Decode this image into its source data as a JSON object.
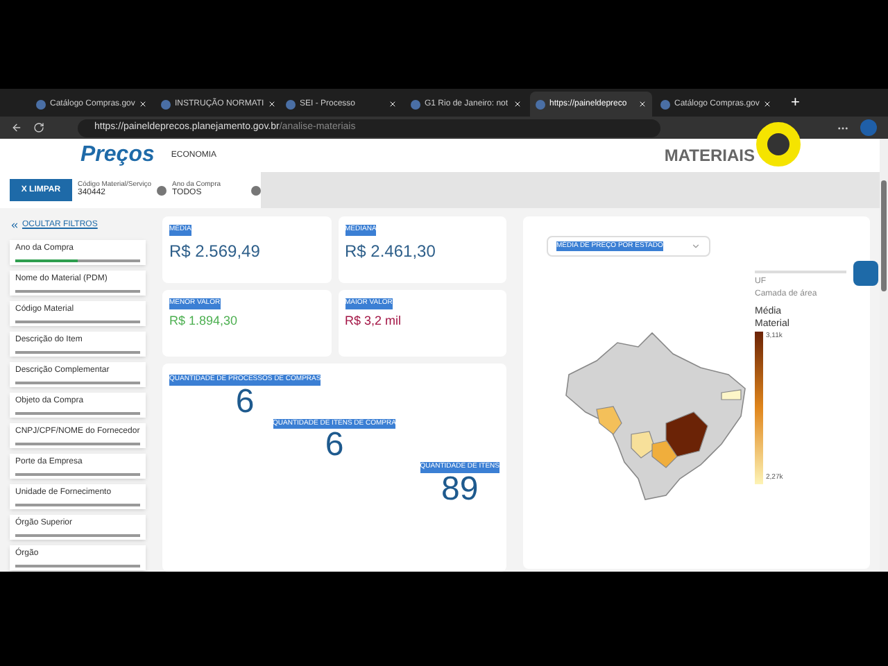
{
  "browser": {
    "tabs": [
      {
        "title": "Catálogo Compras.gov",
        "selected": false
      },
      {
        "title": "INSTRUÇÃO NORMATI",
        "selected": false
      },
      {
        "title": "SEI - Processo",
        "selected": false
      },
      {
        "title": "G1 Rio de Janeiro: not",
        "selected": false
      },
      {
        "title": "https://paineldepreco",
        "selected": true
      },
      {
        "title": "Catálogo Compras.gov",
        "selected": false
      }
    ],
    "new_tab": "+",
    "address": {
      "host": "https://paineldeprecos.planejamento.gov.br",
      "path": "/analise-materiais"
    }
  },
  "header": {
    "logo": "Preços",
    "ministry": "ECONOMIA",
    "title": "MATERIAIS"
  },
  "filter_bar": {
    "clear_button": "X  LIMPAR",
    "chips": [
      {
        "label": "Código Material/Serviço",
        "value": "340442"
      },
      {
        "label": "Ano da Compra",
        "value": "TODOS"
      }
    ]
  },
  "sidebar": {
    "hide_link": "OCULTAR FILTROS",
    "filters": [
      {
        "label": "Ano da Compra",
        "selected": true
      },
      {
        "label": "Nome do Material (PDM)",
        "selected": false
      },
      {
        "label": "Código Material",
        "selected": false
      },
      {
        "label": "Descrição do Item",
        "selected": false
      },
      {
        "label": "Descrição Complementar",
        "selected": false
      },
      {
        "label": "Objeto da Compra",
        "selected": false
      },
      {
        "label": "CNPJ/CPF/NOME do Fornecedor",
        "selected": false
      },
      {
        "label": "Porte da Empresa",
        "selected": false
      },
      {
        "label": "Unidade de Fornecimento",
        "selected": false
      },
      {
        "label": "Órgão Superior",
        "selected": false
      },
      {
        "label": "Órgão",
        "selected": false
      }
    ]
  },
  "stats": [
    {
      "label": "MÉDIA",
      "value": "R$ 2.569,49",
      "color": "#2e5f8a"
    },
    {
      "label": "MEDIANA",
      "value": "R$ 2.461,30",
      "color": "#2e5f8a"
    },
    {
      "label": "MENOR VALOR",
      "value": "R$ 1.894,30",
      "color": "#4caf50"
    },
    {
      "label": "MAIOR VALOR",
      "value": "R$ 3,2 mil",
      "color": "#a31545"
    }
  ],
  "quantities": [
    {
      "label": "QUANTIDADE DE PROCESSOS DE COMPRAS",
      "value": "6"
    },
    {
      "label": "QUANTIDADE DE ITENS DE COMPRA",
      "value": "6"
    },
    {
      "label": "QUANTIDADE DE ITENS",
      "value": "89"
    }
  ],
  "map_panel": {
    "dropdown": "MÉDIA DE PREÇO POR ESTADO",
    "legend": {
      "layer": "UF",
      "layer_type": "Camada de área",
      "title": "Média Material",
      "max": "3,11k",
      "min": "2,27k"
    }
  }
}
